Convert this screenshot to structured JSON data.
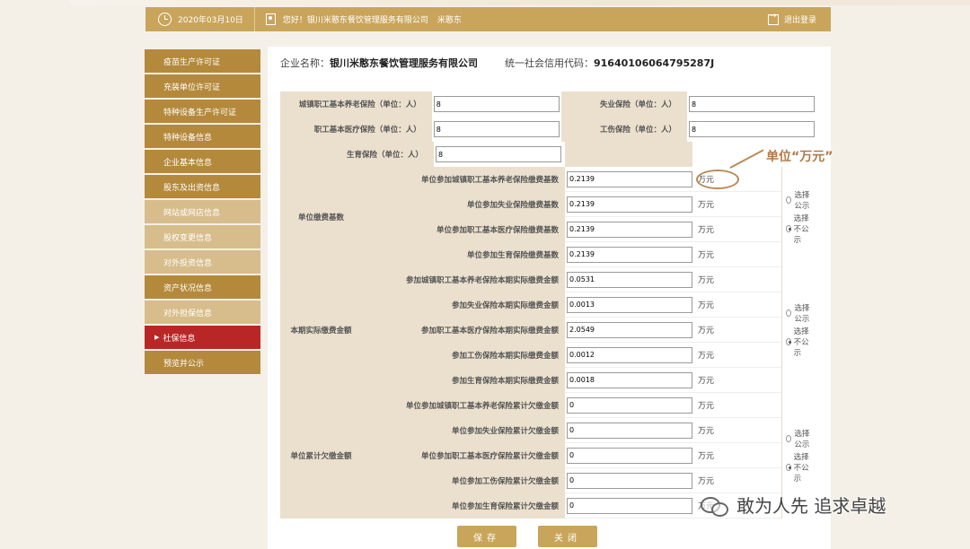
{
  "header": {
    "date": "2020年03月10日",
    "greeting": "您好！银川米憨东餐饮管理服务有限公司",
    "user": "米憨东",
    "logout": "退出登录"
  },
  "sidebar": {
    "items": [
      {
        "label": "疫苗生产许可证",
        "style": "dark"
      },
      {
        "label": "充装单位许可证",
        "style": "dark"
      },
      {
        "label": "特种设备生产许可证",
        "style": "dark"
      },
      {
        "label": "特种设备信息",
        "style": "dark"
      },
      {
        "label": "企业基本信息",
        "style": "dark"
      },
      {
        "label": "股东及出资信息",
        "style": "dark"
      },
      {
        "label": "网站或网店信息",
        "style": "light"
      },
      {
        "label": "股权变更信息",
        "style": "light"
      },
      {
        "label": "对外投资信息",
        "style": "light"
      },
      {
        "label": "资产状况信息",
        "style": "dark"
      },
      {
        "label": "对外担保信息",
        "style": "light"
      },
      {
        "label": "社保信息",
        "style": "active"
      },
      {
        "label": "预览并公示",
        "style": "dark"
      }
    ]
  },
  "company": {
    "name_label": "企业名称：",
    "name": "银川米憨东餐饮管理服务有限公司",
    "code_label": "统一社会信用代码：",
    "code": "91640106064795287J"
  },
  "insurance": {
    "row1_left_label": "城镇职工基本养老保险（单位：人）",
    "row1_left_value": "8",
    "row1_right_label": "失业保险（单位：人）",
    "row1_right_value": "8",
    "row2_left_label": "职工基本医疗保险（单位：人）",
    "row2_left_value": "8",
    "row2_right_label": "工伤保险（单位：人）",
    "row2_right_value": "8",
    "row3_left_label": "生育保险（单位：人）",
    "row3_left_value": "8"
  },
  "groups": [
    {
      "title": "单位缴费基数",
      "rows": [
        {
          "label": "单位参加城镇职工基本养老保险缴费基数",
          "value": "0.2139"
        },
        {
          "label": "单位参加失业保险缴费基数",
          "value": "0.2139"
        },
        {
          "label": "单位参加职工基本医疗保险缴费基数",
          "value": "0.2139"
        },
        {
          "label": "单位参加生育保险缴费基数",
          "value": "0.2139"
        }
      ]
    },
    {
      "title": "本期实际缴费金额",
      "rows": [
        {
          "label": "参加城镇职工基本养老保险本期实际缴费金额",
          "value": "0.0531"
        },
        {
          "label": "参加失业保险本期实际缴费金额",
          "value": "0.0013"
        },
        {
          "label": "参加职工基本医疗保险本期实际缴费金额",
          "value": "2.0549"
        },
        {
          "label": "参加工伤保险本期实际缴费金额",
          "value": "0.0012"
        },
        {
          "label": "参加生育保险本期实际缴费金额",
          "value": "0.0018"
        }
      ]
    },
    {
      "title": "单位累计欠缴金额",
      "rows": [
        {
          "label": "单位参加城镇职工基本养老保险累计欠缴金额",
          "value": "0"
        },
        {
          "label": "单位参加失业保险累计欠缴金额",
          "value": "0"
        },
        {
          "label": "单位参加职工基本医疗保险累计欠缴金额",
          "value": "0"
        },
        {
          "label": "单位参加工伤保险累计欠缴金额",
          "value": "0"
        },
        {
          "label": "单位参加生育保险累计欠缴金额",
          "value": "0"
        }
      ]
    }
  ],
  "unit": "万元",
  "radio": {
    "publish": "选择公示",
    "not_publish": "选择不公示"
  },
  "annotation": "单位“万元”",
  "buttons": {
    "save": "保存",
    "close": "关闭"
  },
  "watermark": "敢为人先 追求卓越"
}
